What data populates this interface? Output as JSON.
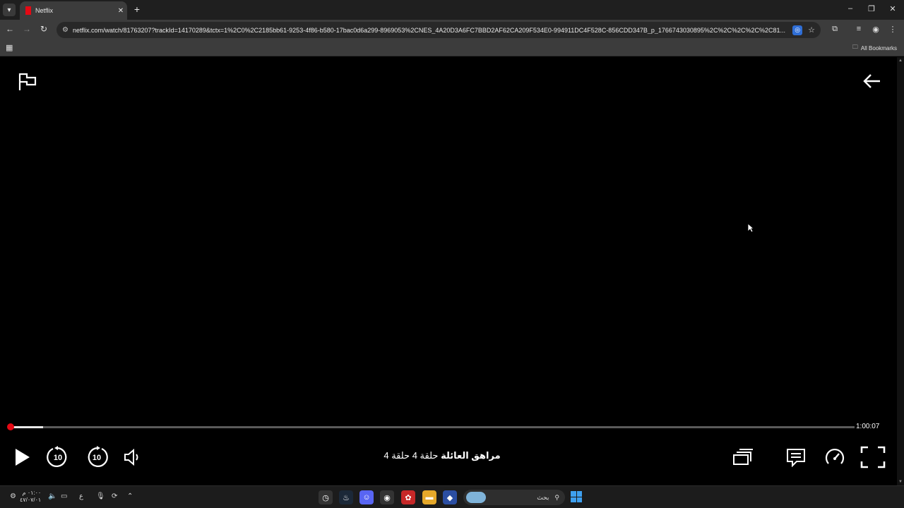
{
  "browser": {
    "tab": {
      "title": "Netflix"
    },
    "url": "netflix.com/watch/81763207?trackId=14170289&tctx=1%2C0%2C2185bb61-9253-4f86-b580-17bac0d6a299-8969053%2CNES_4A20D3A6FC7BBD2AF62CA209F534E0-994911DC4F528C-856CDD347B_p_1766743030895%2C%2C%2C%2C%2C81...",
    "bookmarks_label": "All Bookmarks"
  },
  "player": {
    "time_remaining": "1:00:07",
    "progress_fraction": 0.001,
    "buffered_fraction": 0.039,
    "title_show": "مراهق العائلة",
    "title_episode": "حلقة 4  حلقة 4"
  },
  "taskbar": {
    "clock_time": "٠١:٠٠ م",
    "clock_date": "٤٧/٠٧/٠١",
    "search_placeholder": "بحث",
    "lang": "ع"
  }
}
